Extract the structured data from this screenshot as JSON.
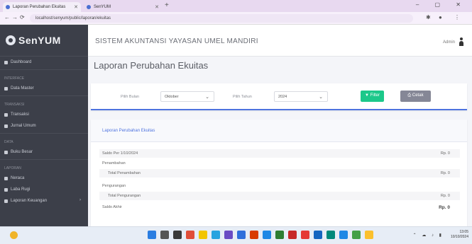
{
  "browser": {
    "tabs": [
      {
        "title": "Laporan Perubahan Ekuitas"
      },
      {
        "title": "SenYUM"
      }
    ],
    "url": "localhost/senyum/public/laporan/ekuitas"
  },
  "sidebar": {
    "brand": "SenYUM",
    "sections": [
      {
        "items": [
          {
            "label": "Dashboard"
          }
        ]
      },
      {
        "heading": "Interface",
        "items": [
          {
            "label": "Data Master"
          }
        ]
      },
      {
        "heading": "Transaksi",
        "items": [
          {
            "label": "Transaksi"
          },
          {
            "label": "Jurnal Umum"
          }
        ]
      },
      {
        "heading": "Data",
        "items": [
          {
            "label": "Buku Besar"
          }
        ]
      },
      {
        "heading": "Laporan",
        "items": [
          {
            "label": "Neraca"
          },
          {
            "label": "Laba Rugi"
          },
          {
            "label": "Laporan Keuangan",
            "has_caret": true
          }
        ]
      }
    ]
  },
  "topbar": {
    "title": "SISTEM AKUNTANSI YAYASAN UMEL MANDIRI",
    "user": "Admin"
  },
  "page": {
    "title": "Laporan Perubahan Ekuitas"
  },
  "filter": {
    "month_label": "Pilih Bulan",
    "month_value": "Oktober",
    "year_label": "Pilih Tahun",
    "year_value": "2024",
    "filter_button": "Filter",
    "print_button": "Cetak"
  },
  "report": {
    "header": "Laporan Perubahan Ekuitas",
    "rows": [
      {
        "label": "Saldo Per 1/10/2024",
        "value": "Rp. 0"
      },
      {
        "label": "Penambahan",
        "value": ""
      },
      {
        "label": "Total Penambahan",
        "value": "Rp. 0"
      },
      {
        "label": "Pengurangan",
        "value": ""
      },
      {
        "label": "Total Pengurangan",
        "value": "Rp. 0"
      },
      {
        "label": "Saldo Akhir",
        "value": "Rp. 0"
      }
    ]
  },
  "taskbar": {
    "time": "13:05",
    "date": "10/10/2024"
  },
  "colors": {
    "sidebar_bg": "#3c3f49",
    "primary": "#4e73df",
    "success": "#1cc88a",
    "secondary": "#858796"
  }
}
